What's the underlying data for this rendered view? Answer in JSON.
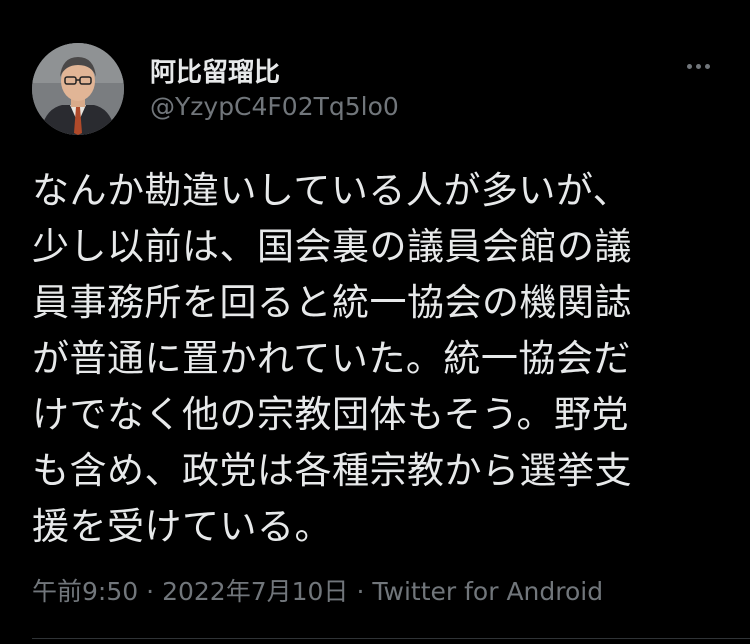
{
  "author": {
    "display_name": "阿比留瑠比",
    "handle": "@YzypC4F02Tq5lo0"
  },
  "tweet": {
    "lines": [
      "なんか勘違いしている人が多いが、",
      "少し以前は、国会裏の議員会館の議",
      "員事務所を回ると統一協会の機関誌",
      "が普通に置かれていた。統一協会だ",
      "けでなく他の宗教団体もそう。野党",
      "も含め、政党は各種宗教から選挙支",
      "援を受けている。"
    ]
  },
  "meta": {
    "time": "午前9:50",
    "separator": "·",
    "date": "2022年7月10日",
    "source": "Twitter for Android"
  },
  "colors": {
    "background": "#000000",
    "text": "#e7e9ea",
    "secondary_text": "#71767b",
    "divider": "#2f3336"
  },
  "icons": {
    "more": "more-dots-icon",
    "avatar": "avatar-photo"
  }
}
